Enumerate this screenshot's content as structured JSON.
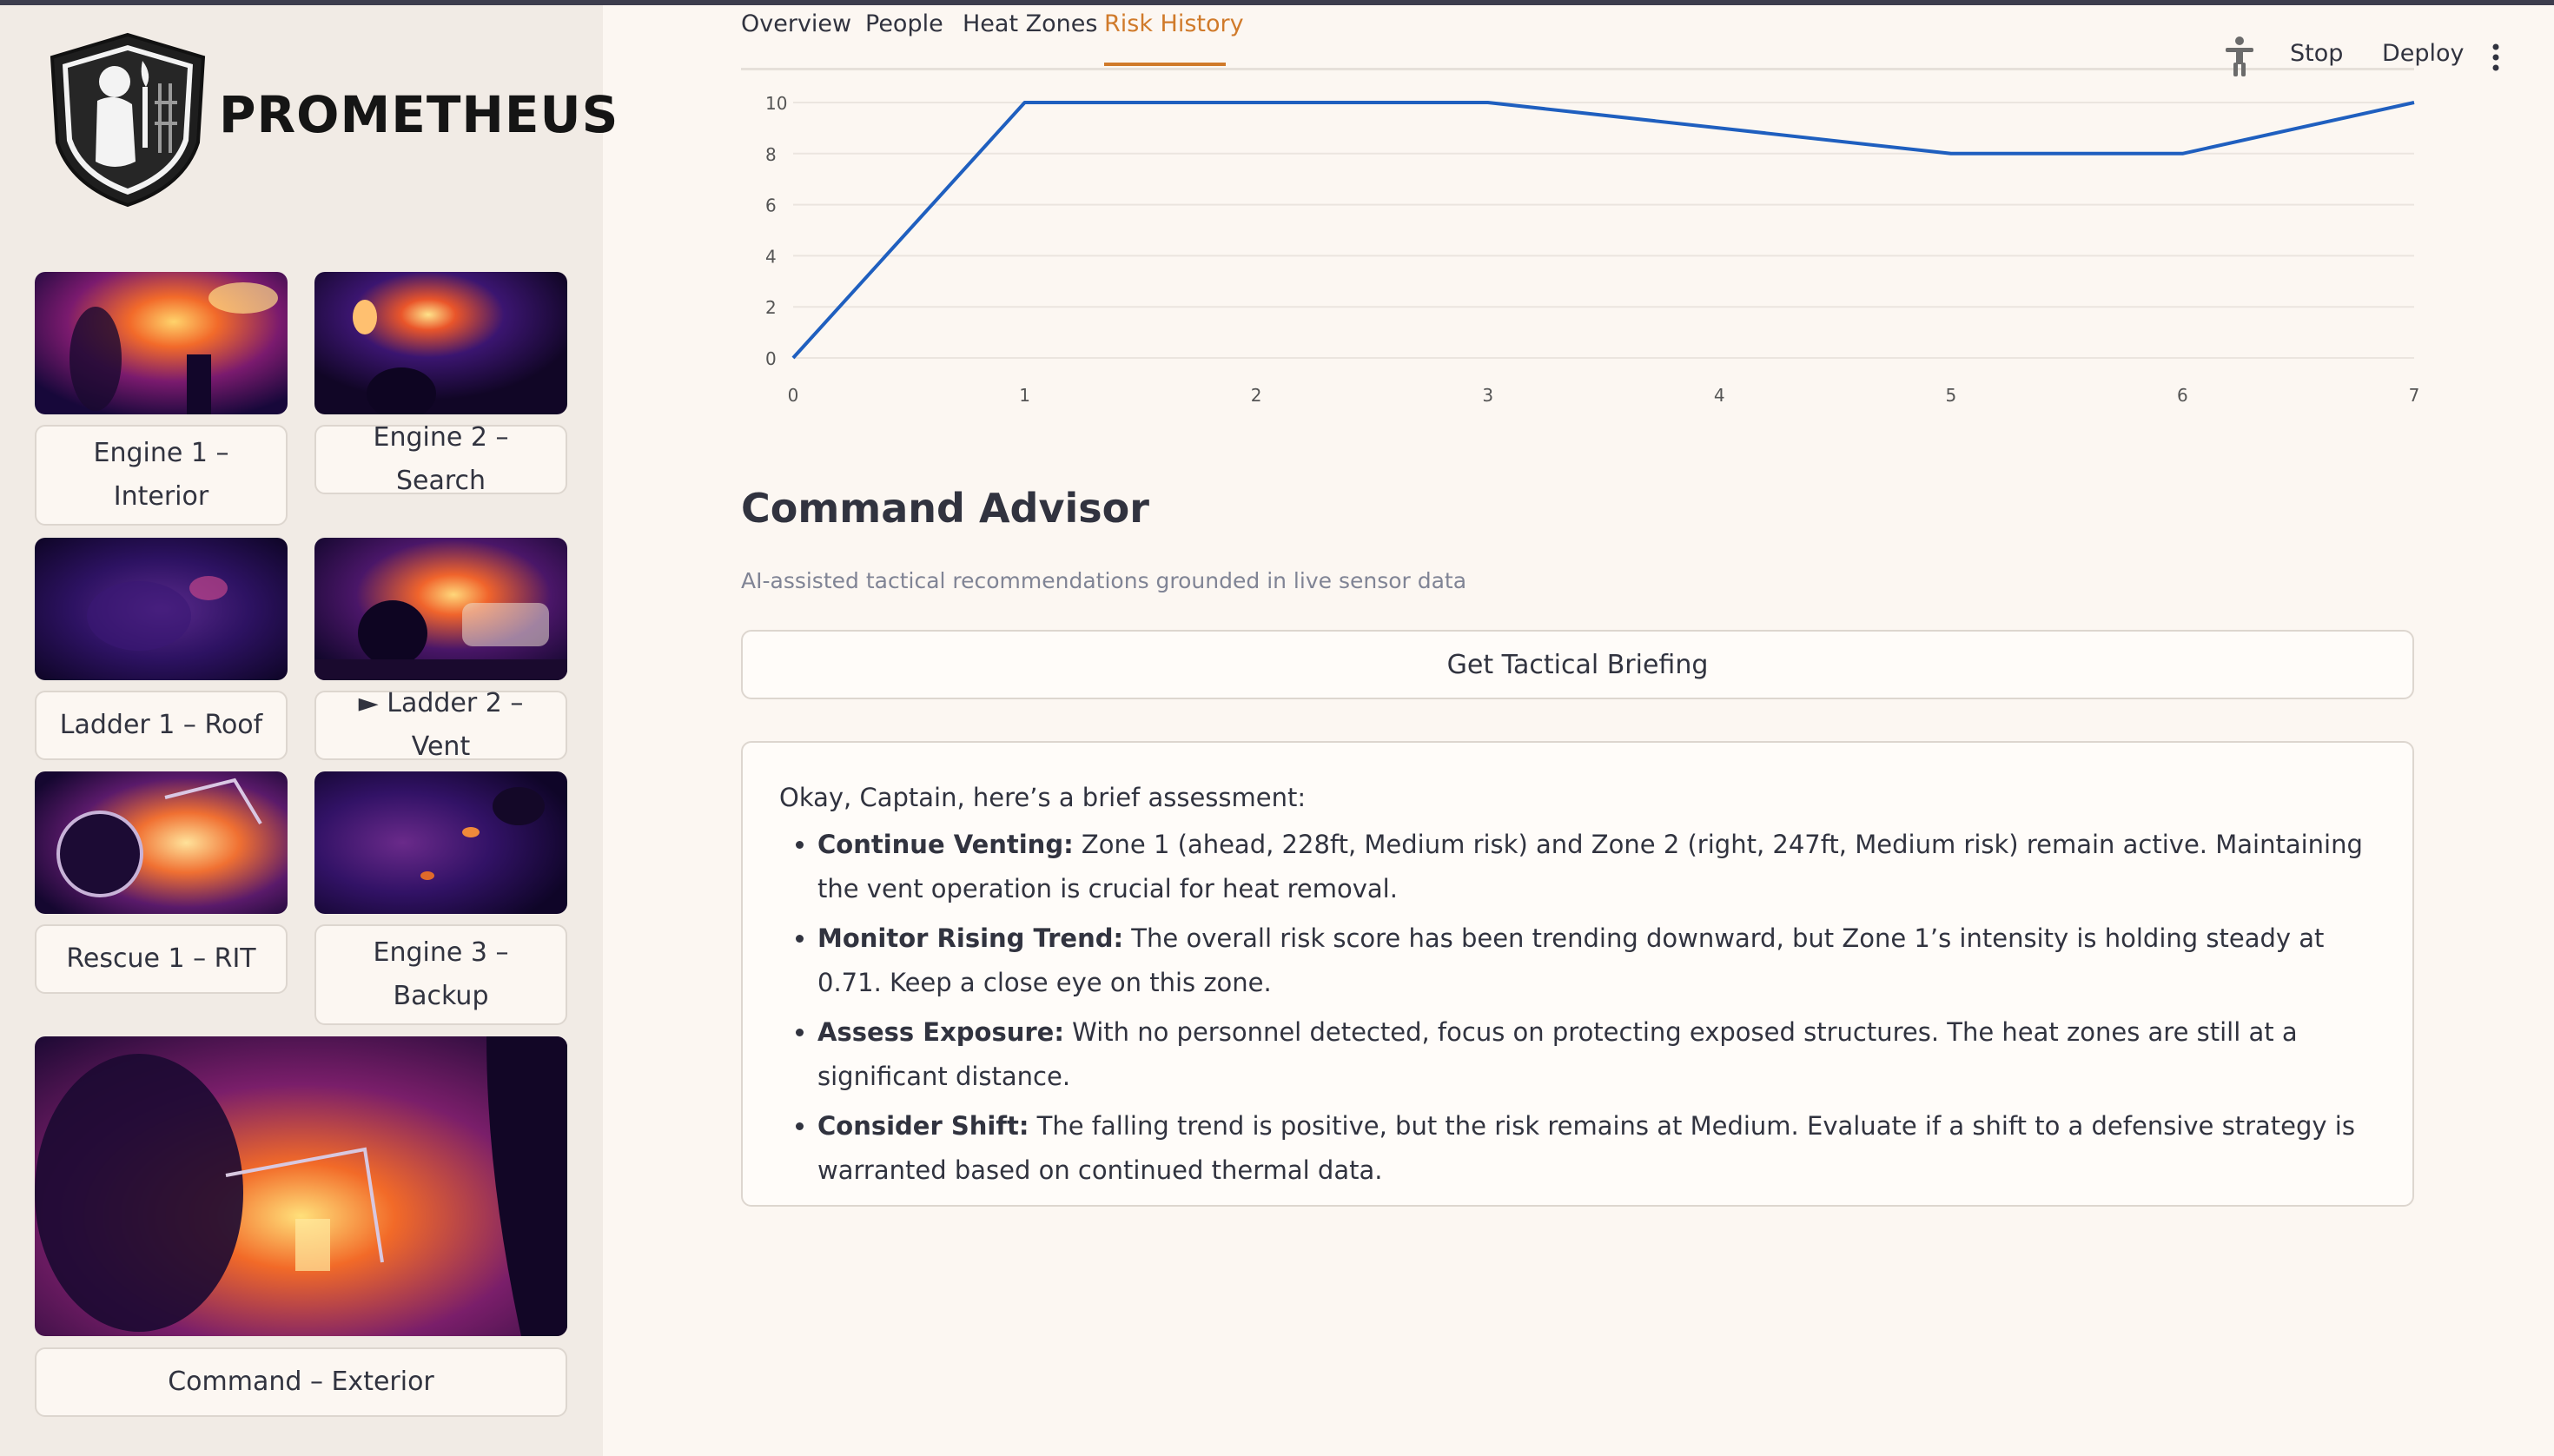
{
  "app": {
    "brand": "PROMETHEUS"
  },
  "header": {
    "tabs": [
      {
        "label": "Overview",
        "active": false
      },
      {
        "label": "People",
        "active": false
      },
      {
        "label": "Heat Zones",
        "active": false
      },
      {
        "label": "Risk History",
        "active": true
      }
    ],
    "toolbar": {
      "running_icon": "accessibility-figure-icon",
      "stop_label": "Stop",
      "deploy_label": "Deploy",
      "menu_icon": "vertical-dots-icon"
    }
  },
  "sidebar": {
    "cameras": [
      {
        "label": "Engine 1 – Interior"
      },
      {
        "label": "Engine 2 – Search"
      },
      {
        "label": "Ladder 1 – Roof"
      },
      {
        "label": "► Ladder 2 – Vent"
      },
      {
        "label": "Rescue 1 – RIT"
      },
      {
        "label": "Engine 3 – Backup"
      },
      {
        "label": "Command – Exterior"
      }
    ]
  },
  "chart_data": {
    "type": "line",
    "x": [
      0,
      1,
      2,
      3,
      4,
      5,
      6,
      7
    ],
    "series": [
      {
        "values": [
          0,
          10,
          10,
          10,
          9,
          8,
          8,
          10
        ]
      }
    ],
    "x_ticks": [
      "0",
      "1",
      "2",
      "3",
      "4",
      "5",
      "6",
      "7"
    ],
    "y_ticks": [
      "0",
      "2",
      "4",
      "6",
      "8",
      "10"
    ],
    "ylim": [
      0,
      10
    ],
    "xlim": [
      0,
      7
    ],
    "grid": true,
    "color": "#1f5fbf"
  },
  "advisor": {
    "title": "Command Advisor",
    "subtitle": "AI-assisted tactical recommendations grounded in live sensor data",
    "button_label": "Get Tactical Briefing",
    "intro": "Okay, Captain, here’s a brief assessment:",
    "items": [
      {
        "heading": "Continue Venting:",
        "text": " Zone 1 (ahead, 228ft, Medium risk) and Zone 2 (right, 247ft, Medium risk) remain active. Maintaining the vent operation is crucial for heat removal."
      },
      {
        "heading": "Monitor Rising Trend:",
        "text": " The overall risk score has been trending downward, but Zone 1’s intensity is holding steady at 0.71. Keep a close eye on this zone."
      },
      {
        "heading": "Assess Exposure:",
        "text": " With no personnel detected, focus on protecting exposed structures. The heat zones are still at a significant distance."
      },
      {
        "heading": "Consider Shift:",
        "text": " The falling trend is positive, but the risk remains at Medium. Evaluate if a shift to a defensive strategy is warranted based on continued thermal data."
      }
    ]
  },
  "colors": {
    "accent": "#d07a2a",
    "line": "#1f5fbf",
    "background": "#fcf7f2",
    "sidebar": "#f1ebe5"
  }
}
